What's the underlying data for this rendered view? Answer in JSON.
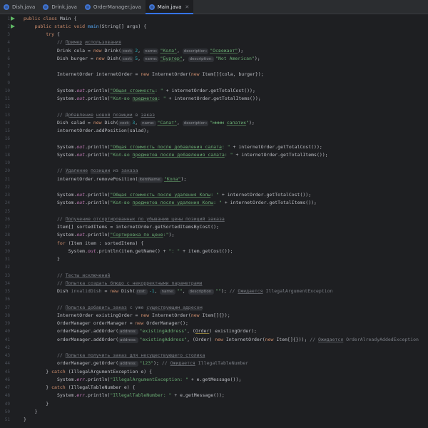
{
  "tabs": [
    {
      "label": "Dish.java",
      "active": false
    },
    {
      "label": "Drink.java",
      "active": false
    },
    {
      "label": "OrderManager.java",
      "active": false
    },
    {
      "label": "Main.java",
      "active": true
    }
  ],
  "editor": {
    "lines": [
      {
        "n": "1",
        "run": true,
        "tokens": [
          {
            "t": "public class ",
            "c": "kw"
          },
          {
            "t": "Main {"
          }
        ]
      },
      {
        "n": "2",
        "run": true,
        "tokens": [
          {
            "t": "    "
          },
          {
            "t": "public static void ",
            "c": "kw"
          },
          {
            "t": "main",
            "c": "fn"
          },
          {
            "t": "(String[] args) {"
          }
        ]
      },
      {
        "n": "3",
        "tokens": [
          {
            "t": "        "
          },
          {
            "t": "try ",
            "c": "kw"
          },
          {
            "t": "{"
          }
        ]
      },
      {
        "n": "4",
        "tokens": [
          {
            "t": "            "
          },
          {
            "t": "// ",
            "c": "cm"
          },
          {
            "t": "Пример",
            "c": "cmu"
          },
          {
            "t": " ",
            "c": "cm"
          },
          {
            "t": "использования",
            "c": "cmu"
          }
        ]
      },
      {
        "n": "5",
        "tokens": [
          {
            "t": "            Drink cola = "
          },
          {
            "t": "new ",
            "c": "kw"
          },
          {
            "t": "Drink("
          },
          {
            "t": "cost:",
            "c": "hint"
          },
          {
            "t": "2",
            "c": "num"
          },
          {
            "t": ", "
          },
          {
            "t": "name:",
            "c": "hint"
          },
          {
            "t": "\"Кола\"",
            "c": "strul"
          },
          {
            "t": ", "
          },
          {
            "t": "description:",
            "c": "hint"
          },
          {
            "t": "\"Освежает\"",
            "c": "strul"
          },
          {
            "t": ");"
          }
        ]
      },
      {
        "n": "6",
        "tokens": [
          {
            "t": "            Dish burger = "
          },
          {
            "t": "new ",
            "c": "kw"
          },
          {
            "t": "Dish("
          },
          {
            "t": "cost:",
            "c": "hint"
          },
          {
            "t": "5",
            "c": "num"
          },
          {
            "t": ", "
          },
          {
            "t": "name:",
            "c": "hint"
          },
          {
            "t": "\"Бургер\"",
            "c": "strul"
          },
          {
            "t": ", "
          },
          {
            "t": "description:",
            "c": "hint"
          },
          {
            "t": "\"Not American\"",
            "c": "str"
          },
          {
            "t": ");"
          }
        ]
      },
      {
        "n": "7",
        "tokens": []
      },
      {
        "n": "8",
        "tokens": [
          {
            "t": "            InternetOrder internetOrder = "
          },
          {
            "t": "new ",
            "c": "kw"
          },
          {
            "t": "InternetOrder("
          },
          {
            "t": "new ",
            "c": "kw"
          },
          {
            "t": "Item[]{cola, burger});"
          }
        ]
      },
      {
        "n": "9",
        "tokens": []
      },
      {
        "n": "10",
        "tokens": [
          {
            "t": "            System."
          },
          {
            "t": "out",
            "c": "field"
          },
          {
            "t": ".println("
          },
          {
            "t": "\"Общая стоимость",
            "c": "strul"
          },
          {
            "t": ": \"",
            "c": "str"
          },
          {
            "t": " + internetOrder.getTotalCost());"
          }
        ]
      },
      {
        "n": "11",
        "tokens": [
          {
            "t": "            System."
          },
          {
            "t": "out",
            "c": "field"
          },
          {
            "t": ".println("
          },
          {
            "t": "\"Кол-во ",
            "c": "str"
          },
          {
            "t": "предметов",
            "c": "strul"
          },
          {
            "t": ": \"",
            "c": "str"
          },
          {
            "t": " + internetOrder.getTotalItems());"
          }
        ]
      },
      {
        "n": "12",
        "tokens": []
      },
      {
        "n": "13",
        "tokens": [
          {
            "t": "            "
          },
          {
            "t": "// ",
            "c": "cm"
          },
          {
            "t": "Добавление",
            "c": "cmu"
          },
          {
            "t": " ",
            "c": "cm"
          },
          {
            "t": "новой",
            "c": "cmu"
          },
          {
            "t": " ",
            "c": "cm"
          },
          {
            "t": "позиции",
            "c": "cmu"
          },
          {
            "t": " в ",
            "c": "cm"
          },
          {
            "t": "заказ",
            "c": "cmu"
          }
        ]
      },
      {
        "n": "14",
        "tokens": [
          {
            "t": "            Dish salad = "
          },
          {
            "t": "new ",
            "c": "kw"
          },
          {
            "t": "Dish("
          },
          {
            "t": "cost:",
            "c": "hint"
          },
          {
            "t": "3",
            "c": "num"
          },
          {
            "t": ", "
          },
          {
            "t": "name:",
            "c": "hint"
          },
          {
            "t": "\"Салат\"",
            "c": "strul"
          },
          {
            "t": ", "
          },
          {
            "t": "description:",
            "c": "hint"
          },
          {
            "t": "\"мммм ",
            "c": "str"
          },
          {
            "t": "салатик",
            "c": "strul"
          },
          {
            "t": "\"",
            "c": "str"
          },
          {
            "t": ");"
          }
        ]
      },
      {
        "n": "15",
        "tokens": [
          {
            "t": "            internetOrder.addPosition(salad);"
          }
        ]
      },
      {
        "n": "16",
        "tokens": []
      },
      {
        "n": "17",
        "tokens": [
          {
            "t": "            System."
          },
          {
            "t": "out",
            "c": "field"
          },
          {
            "t": ".println("
          },
          {
            "t": "\"Общая стоимость после добавления салата",
            "c": "strul"
          },
          {
            "t": ": \"",
            "c": "str"
          },
          {
            "t": " + internetOrder.getTotalCost());"
          }
        ]
      },
      {
        "n": "18",
        "tokens": [
          {
            "t": "            System."
          },
          {
            "t": "out",
            "c": "field"
          },
          {
            "t": ".println("
          },
          {
            "t": "\"Кол-во ",
            "c": "str"
          },
          {
            "t": "предметов после добавления салата",
            "c": "strul"
          },
          {
            "t": ": \"",
            "c": "str"
          },
          {
            "t": " + internetOrder.getTotalItems());"
          }
        ]
      },
      {
        "n": "19",
        "tokens": []
      },
      {
        "n": "20",
        "tokens": [
          {
            "t": "            "
          },
          {
            "t": "// ",
            "c": "cm"
          },
          {
            "t": "Удаление",
            "c": "cmu"
          },
          {
            "t": " ",
            "c": "cm"
          },
          {
            "t": "позиции",
            "c": "cmu"
          },
          {
            "t": " из ",
            "c": "cm"
          },
          {
            "t": "заказа",
            "c": "cmu"
          }
        ]
      },
      {
        "n": "21",
        "tokens": [
          {
            "t": "            internetOrder.removePosition("
          },
          {
            "t": "itemName:",
            "c": "hint"
          },
          {
            "t": "\"Кола\"",
            "c": "strul"
          },
          {
            "t": ");"
          }
        ]
      },
      {
        "n": "22",
        "tokens": []
      },
      {
        "n": "23",
        "tokens": [
          {
            "t": "            System."
          },
          {
            "t": "out",
            "c": "field"
          },
          {
            "t": ".println("
          },
          {
            "t": "\"Общая стоимость после удаления Колы",
            "c": "strul"
          },
          {
            "t": ": \"",
            "c": "str"
          },
          {
            "t": " + internetOrder.getTotalCost());"
          }
        ]
      },
      {
        "n": "24",
        "tokens": [
          {
            "t": "            System."
          },
          {
            "t": "out",
            "c": "field"
          },
          {
            "t": ".println("
          },
          {
            "t": "\"Кол-во ",
            "c": "str"
          },
          {
            "t": "предметов после удаления Колы",
            "c": "strul"
          },
          {
            "t": ": \"",
            "c": "str"
          },
          {
            "t": " + internetOrder.getTotalItems());"
          }
        ]
      },
      {
        "n": "25",
        "tokens": []
      },
      {
        "n": "26",
        "tokens": [
          {
            "t": "            "
          },
          {
            "t": "// ",
            "c": "cm"
          },
          {
            "t": "Получение отсортированных по убыванию цены позиций заказа",
            "c": "cmu"
          }
        ]
      },
      {
        "n": "27",
        "tokens": [
          {
            "t": "            Item[] sortedItems = internetOrder.getSortedItemsByCost();"
          }
        ]
      },
      {
        "n": "28",
        "tokens": [
          {
            "t": "            System."
          },
          {
            "t": "out",
            "c": "field"
          },
          {
            "t": ".println("
          },
          {
            "t": "\"Сортировка по цене",
            "c": "strul"
          },
          {
            "t": ":\"",
            "c": "str"
          },
          {
            "t": ");"
          }
        ]
      },
      {
        "n": "29",
        "tokens": [
          {
            "t": "            "
          },
          {
            "t": "for ",
            "c": "kw"
          },
          {
            "t": "(Item item : sortedItems) {"
          }
        ]
      },
      {
        "n": "30",
        "tokens": [
          {
            "t": "                System."
          },
          {
            "t": "out",
            "c": "field"
          },
          {
            "t": ".println(item.getName() + "
          },
          {
            "t": "\": \"",
            "c": "str"
          },
          {
            "t": " + item.getCost());"
          }
        ]
      },
      {
        "n": "31",
        "tokens": [
          {
            "t": "            }"
          }
        ]
      },
      {
        "n": "32",
        "tokens": []
      },
      {
        "n": "33",
        "tokens": [
          {
            "t": "            "
          },
          {
            "t": "// ",
            "c": "cm"
          },
          {
            "t": "Тесты исключений",
            "c": "cmu"
          }
        ]
      },
      {
        "n": "34",
        "tokens": [
          {
            "t": "            "
          },
          {
            "t": "// ",
            "c": "cm"
          },
          {
            "t": "Попытка создать блюдо с некорректными параметрами",
            "c": "cmu"
          }
        ]
      },
      {
        "n": "35",
        "tokens": [
          {
            "t": "            Dish "
          },
          {
            "t": "invalidDish",
            "c": "unused"
          },
          {
            "t": " = "
          },
          {
            "t": "new ",
            "c": "kw"
          },
          {
            "t": "Dish("
          },
          {
            "t": "cost:",
            "c": "hint"
          },
          {
            "t": "-1",
            "c": "num"
          },
          {
            "t": ", "
          },
          {
            "t": "name:",
            "c": "hint"
          },
          {
            "t": "\"\"",
            "c": "str"
          },
          {
            "t": ", "
          },
          {
            "t": "description:",
            "c": "hint"
          },
          {
            "t": "\"\"",
            "c": "str"
          },
          {
            "t": "); "
          },
          {
            "t": "// ",
            "c": "cm"
          },
          {
            "t": "Ожидается",
            "c": "cmu"
          },
          {
            "t": " IllegalArgumentException",
            "c": "cm"
          }
        ]
      },
      {
        "n": "36",
        "tokens": []
      },
      {
        "n": "37",
        "tokens": [
          {
            "t": "            "
          },
          {
            "t": "// ",
            "c": "cm"
          },
          {
            "t": "Попытка добавить заказ",
            "c": "cmu"
          },
          {
            "t": " с уже ",
            "c": "cm"
          },
          {
            "t": "существующим адресом",
            "c": "cmu"
          }
        ]
      },
      {
        "n": "38",
        "tokens": [
          {
            "t": "            InternetOrder existingOrder = "
          },
          {
            "t": "new ",
            "c": "kw"
          },
          {
            "t": "InternetOrder("
          },
          {
            "t": "new ",
            "c": "kw"
          },
          {
            "t": "Item[]{});"
          }
        ]
      },
      {
        "n": "39",
        "tokens": [
          {
            "t": "            OrderManager orderManager = "
          },
          {
            "t": "new ",
            "c": "kw"
          },
          {
            "t": "OrderManager();"
          }
        ]
      },
      {
        "n": "40",
        "tokens": [
          {
            "t": "            orderManager.addOrder("
          },
          {
            "t": "address:",
            "c": "hint"
          },
          {
            "t": "\"existingAddress\"",
            "c": "str"
          },
          {
            "t": ", ("
          },
          {
            "t": "Order",
            "c": "warn"
          },
          {
            "t": ") existingOrder);"
          }
        ]
      },
      {
        "n": "41",
        "tokens": [
          {
            "t": "            orderManager.addOrder("
          },
          {
            "t": "address:",
            "c": "hint"
          },
          {
            "t": "\"existingAddress\"",
            "c": "str"
          },
          {
            "t": ", (Order) "
          },
          {
            "t": "new ",
            "c": "kw"
          },
          {
            "t": "InternetOrder("
          },
          {
            "t": "new ",
            "c": "kw"
          },
          {
            "t": "Item[]{})); "
          },
          {
            "t": "// ",
            "c": "cm"
          },
          {
            "t": "Ожидается",
            "c": "cmu"
          },
          {
            "t": " OrderAlreadyAddedException",
            "c": "cm"
          }
        ]
      },
      {
        "n": "42",
        "tokens": []
      },
      {
        "n": "43",
        "tokens": [
          {
            "t": "            "
          },
          {
            "t": "// ",
            "c": "cm"
          },
          {
            "t": "Попытка получить заказ для несуществующего столика",
            "c": "cmu"
          }
        ]
      },
      {
        "n": "44",
        "tokens": [
          {
            "t": "            orderManager.getOrder("
          },
          {
            "t": "address:",
            "c": "hint"
          },
          {
            "t": "\"123\"",
            "c": "str"
          },
          {
            "t": "); "
          },
          {
            "t": "// ",
            "c": "cm"
          },
          {
            "t": "Ожидается",
            "c": "cmu"
          },
          {
            "t": " IllegalTableNumber",
            "c": "cm"
          }
        ]
      },
      {
        "n": "45",
        "tokens": [
          {
            "t": "        } "
          },
          {
            "t": "catch ",
            "c": "kw"
          },
          {
            "t": "(IllegalArgumentException e) {"
          }
        ]
      },
      {
        "n": "46",
        "tokens": [
          {
            "t": "            System."
          },
          {
            "t": "err",
            "c": "field"
          },
          {
            "t": ".println("
          },
          {
            "t": "\"IllegalArgumentException: \"",
            "c": "str"
          },
          {
            "t": " + e.getMessage());"
          }
        ]
      },
      {
        "n": "47",
        "tokens": [
          {
            "t": "        } "
          },
          {
            "t": "catch ",
            "c": "kw"
          },
          {
            "t": "(IllegalTableNumber e) {"
          }
        ]
      },
      {
        "n": "48",
        "tokens": [
          {
            "t": "            System."
          },
          {
            "t": "err",
            "c": "field"
          },
          {
            "t": ".println("
          },
          {
            "t": "\"IllegalTableNumber: \"",
            "c": "str"
          },
          {
            "t": " + e.getMessage());"
          }
        ]
      },
      {
        "n": "49",
        "tokens": [
          {
            "t": "        }"
          }
        ]
      },
      {
        "n": "50",
        "tokens": [
          {
            "t": "    }"
          }
        ]
      },
      {
        "n": "51",
        "tokens": [
          {
            "t": "}"
          }
        ]
      }
    ]
  },
  "colors": {
    "keyword": "#cf8e6d",
    "method": "#56a8f5",
    "string": "#6aab73",
    "number": "#2aacb8",
    "comment": "#7a7e85",
    "field": "#c77dbb",
    "background": "#1e1f22",
    "tab_accent": "#3574f0"
  }
}
